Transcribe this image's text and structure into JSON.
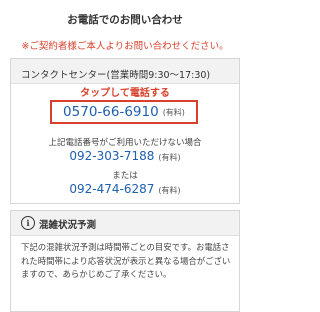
{
  "page_title": "お電話でのお問い合わせ",
  "notice": "※ご契約者様ご本人よりお問い合わせください。",
  "contact": {
    "center_name": "コンタクトセンター(営業時間9:30〜17:30)",
    "tap_label": "タップして電話する",
    "main_phone": "0570-66-6910",
    "main_fee": "(有料)",
    "alt_note": "上記電話番号がご利用いただけない場合",
    "alt_phone_1": "092-303-7188",
    "alt_fee_1": "(有料)",
    "or_label": "または",
    "alt_phone_2": "092-474-6287",
    "alt_fee_2": "(有料)"
  },
  "crowd": {
    "icon": "info-icon",
    "title": "混雑状況予測",
    "description": "下記の混雑状況予測は時間帯ごとの目安です。お電話された時間帯により応答状況が表示と異なる場合がございますので、あらかじめご了承ください。"
  },
  "colors": {
    "accent_red": "#d9402b",
    "link_blue": "#1f5fb0",
    "header_gray": "#f2f2f2"
  }
}
